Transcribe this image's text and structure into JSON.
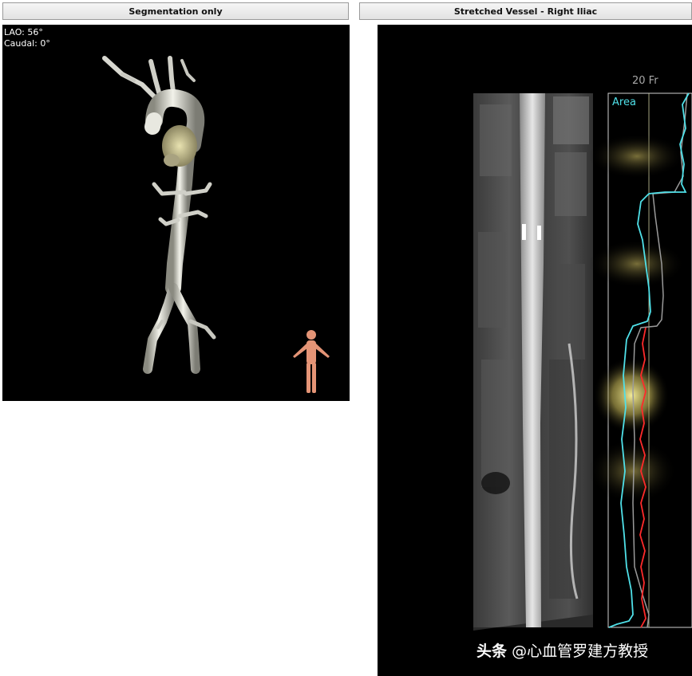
{
  "panels": {
    "left": {
      "title": "Segmentation only",
      "angle_lao": "LAO: 56°",
      "angle_caudal": "Caudal: 0°"
    },
    "right": {
      "title": "Stretched Vessel - Right Iliac",
      "scale_label": "20 Fr",
      "graph_label": "Area"
    }
  },
  "watermark": {
    "source": "头条",
    "handle": "@心血管罗建方教授"
  },
  "colors": {
    "background": "#000000",
    "area_curve": "#4fe0e8",
    "diameter_curve": "#ff2a2a",
    "secondary_curve": "#9a9a9a",
    "calcium_highlight": "#fff7a0"
  },
  "icons": {
    "orientation": "human-figure-icon"
  }
}
